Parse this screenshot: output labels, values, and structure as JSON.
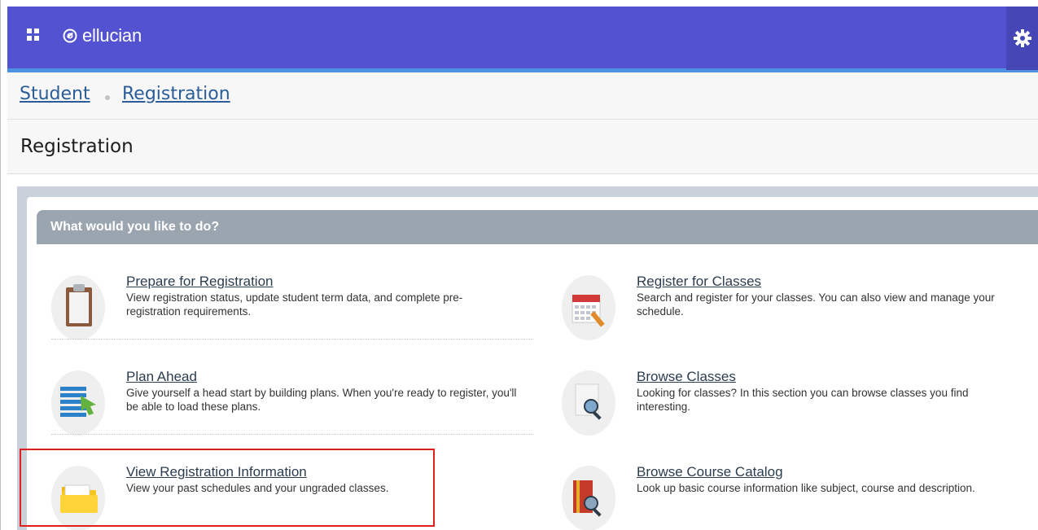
{
  "header": {
    "brand": "ellucian",
    "apps_icon": "apps-grid-icon",
    "logo_icon": "ellucian-logo-icon",
    "settings_icon": "gear-icon",
    "colors": {
      "bar": "#5353d1",
      "accent": "#4c92e1"
    }
  },
  "breadcrumb": {
    "items": [
      {
        "label": "Student"
      },
      {
        "label": "Registration"
      }
    ]
  },
  "page": {
    "title": "Registration"
  },
  "section": {
    "title": "What would you like to do?"
  },
  "actions": [
    {
      "title": "Prepare for Registration",
      "description": "View registration status, update student term data, and complete pre-registration requirements.",
      "icon": "clipboard-icon"
    },
    {
      "title": "Register for Classes",
      "description": "Search and register for your classes. You can also view and manage your schedule.",
      "icon": "calendar-icon"
    },
    {
      "title": "Plan Ahead",
      "description": "Give yourself a head start by building plans. When you're ready to register, you'll be able to load these plans.",
      "icon": "plan-list-icon"
    },
    {
      "title": "Browse Classes",
      "description": "Looking for classes? In this section you can browse classes you find interesting.",
      "icon": "document-search-icon"
    },
    {
      "title": "View Registration Information",
      "description": "View your past schedules and your ungraded classes.",
      "icon": "folder-icon"
    },
    {
      "title": "Browse Course Catalog",
      "description": "Look up basic course information like subject, course and description.",
      "icon": "catalog-search-icon"
    }
  ]
}
